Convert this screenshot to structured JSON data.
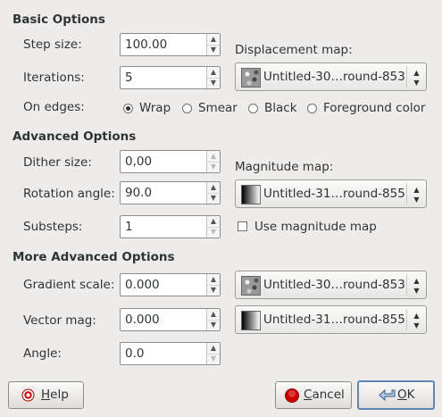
{
  "sections": {
    "basic": "Basic Options",
    "advanced": "Advanced Options",
    "more_advanced": "More Advanced Options"
  },
  "fields": {
    "step_size": {
      "label": "Step size:",
      "value": "100.00"
    },
    "iterations": {
      "label": "Iterations:",
      "value": "5"
    },
    "on_edges_label": "On edges:",
    "dither_size": {
      "label": "Dither size:",
      "value": "0,00"
    },
    "rotation_angle": {
      "label": "Rotation angle:",
      "value": "90.0"
    },
    "substeps": {
      "label": "Substeps:",
      "value": "1"
    },
    "gradient_scale": {
      "label": "Gradient scale:",
      "value": "0.000"
    },
    "vector_mag": {
      "label": "Vector mag:",
      "value": "0.000"
    },
    "angle": {
      "label": "Angle:",
      "value": "0.0"
    }
  },
  "edges": {
    "options": [
      "Wrap",
      "Smear",
      "Black",
      "Foreground color"
    ],
    "selected": "Wrap"
  },
  "maps": {
    "displacement_label": "Displacement map:",
    "displacement_value": "Untitled-30…round-853",
    "magnitude_label": "Magnitude map:",
    "magnitude_value": "Untitled-31…round-855",
    "use_magnitude_label": "Use magnitude map",
    "use_magnitude_checked": false,
    "gradient_value": "Untitled-30…round-853",
    "vector_value": "Untitled-31…round-855"
  },
  "buttons": {
    "help_first": "H",
    "help_rest": "elp",
    "cancel_first": "C",
    "cancel_rest": "ancel",
    "ok_first": "O",
    "ok_rest": "K"
  },
  "icons": {
    "help": "help-icon",
    "cancel": "cancel-icon",
    "ok": "ok-arrow-icon"
  },
  "colors": {
    "background": "#edeceb",
    "default_button_border": "#5e87b8",
    "cancel_icon": "#cc0000"
  }
}
